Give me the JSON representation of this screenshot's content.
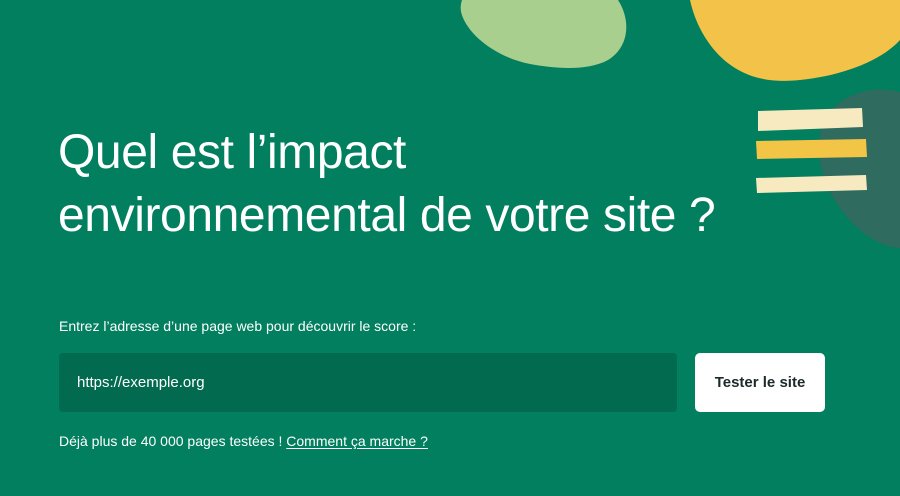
{
  "hero": {
    "title_line1": "Quel est l’impact",
    "title_line2": "environnemental de votre site ?"
  },
  "form": {
    "instruction": "Entrez l’adresse d’une page web pour découvrir le score :",
    "url_placeholder": "https://exemple.org",
    "submit_label": "Tester le site"
  },
  "footer_note": {
    "text": "Déjà plus de 40 000 pages testées ! ",
    "link_label": "Comment ça marche ?"
  },
  "colors": {
    "background": "#017f5f",
    "input_background": "#016a4f",
    "blob_light_green": "#a8cf8e",
    "blob_yellow": "#f3c349",
    "blob_dark": "#2f6b5e",
    "stripe_cream": "#f8eac0",
    "stripe_yellow": "#f2c547"
  },
  "icons": {
    "decoration": "abstract-blobs-and-stripes"
  }
}
